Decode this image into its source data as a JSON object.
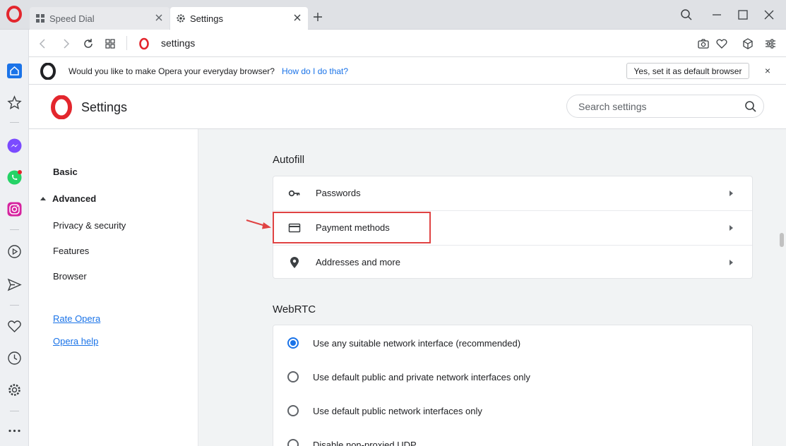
{
  "tabs": [
    {
      "label": "Speed Dial",
      "icon": "grid-icon",
      "active": false
    },
    {
      "label": "Settings",
      "icon": "gear-icon",
      "active": true
    }
  ],
  "address": {
    "url": "settings"
  },
  "infobar": {
    "message": "Would you like to make Opera your everyday browser?",
    "link": "How do I do that?",
    "button": "Yes, set it as default browser",
    "close": "×"
  },
  "header": {
    "title": "Settings",
    "search_placeholder": "Search settings"
  },
  "nav": {
    "basic": "Basic",
    "advanced": "Advanced",
    "items": [
      "Privacy & security",
      "Features",
      "Browser"
    ],
    "links": [
      "Rate Opera",
      "Opera help"
    ]
  },
  "autofill": {
    "title": "Autofill",
    "rows": [
      {
        "label": "Passwords",
        "icon": "key-icon"
      },
      {
        "label": "Payment methods",
        "icon": "credit-card-icon"
      },
      {
        "label": "Addresses and more",
        "icon": "location-pin-icon"
      }
    ]
  },
  "webrtc": {
    "title": "WebRTC",
    "options": [
      {
        "label": "Use any suitable network interface (recommended)",
        "checked": true
      },
      {
        "label": "Use default public and private network interfaces only",
        "checked": false
      },
      {
        "label": "Use default public network interfaces only",
        "checked": false
      },
      {
        "label": "Disable non-proxied UDP",
        "checked": false
      }
    ]
  },
  "colors": {
    "opera_red": "#e3262d",
    "accent_blue": "#1a73e8",
    "highlight_red": "#e04343"
  }
}
